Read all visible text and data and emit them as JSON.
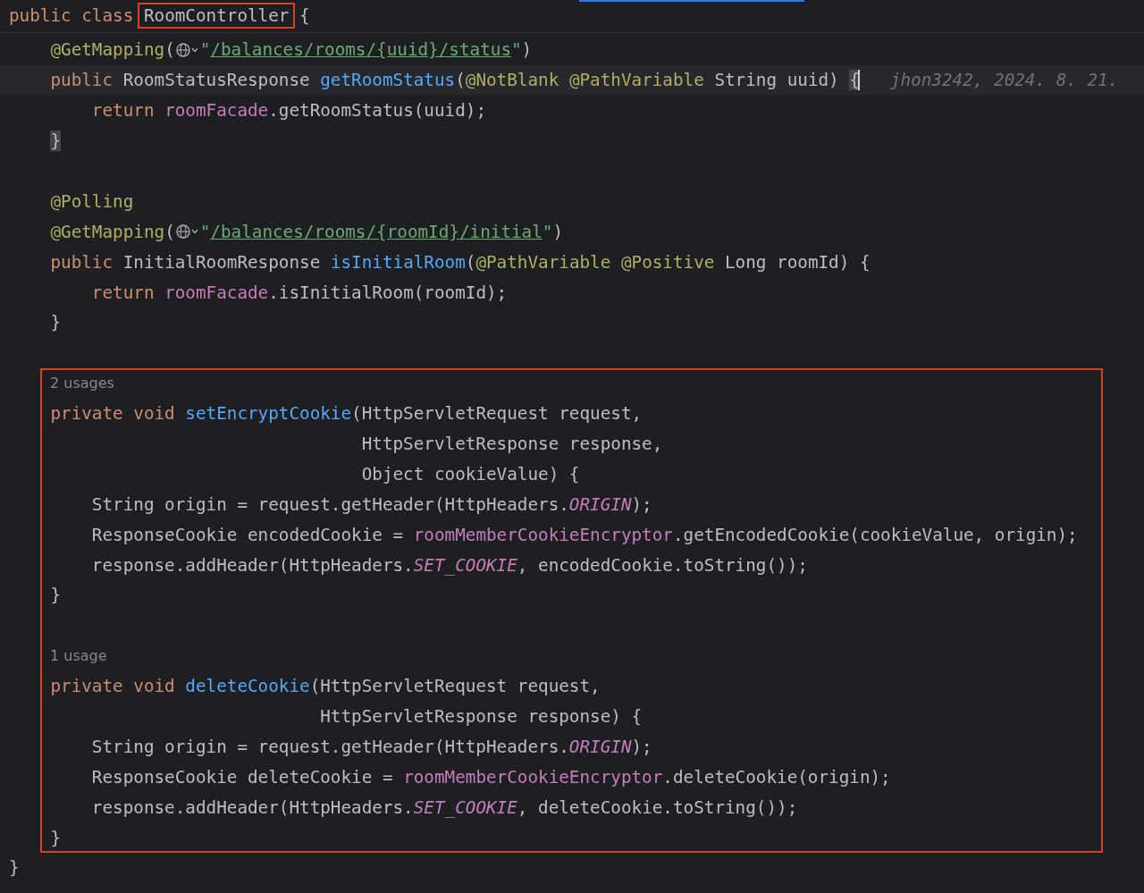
{
  "editor": {
    "sticky_header": {
      "tokens": [
        {
          "text": "public class ",
          "kind": "keyword"
        },
        {
          "text": "RoomController",
          "kind": "plain",
          "boxed": true
        },
        {
          "text": " {",
          "kind": "plain"
        }
      ]
    },
    "sections": [
      {
        "lines": [
          {
            "kind": "code",
            "tokens": [
              {
                "text": "    @GetMapping",
                "kind": "annotation"
              },
              {
                "text": "(",
                "kind": "plain"
              },
              {
                "kind": "globe"
              },
              {
                "text": "\"",
                "kind": "string"
              },
              {
                "text": "/balances/rooms/{uuid}/status",
                "kind": "url"
              },
              {
                "text": "\"",
                "kind": "string"
              },
              {
                "text": ")",
                "kind": "plain"
              }
            ]
          },
          {
            "kind": "code",
            "current": true,
            "tokens": [
              {
                "text": "    public ",
                "kind": "keyword"
              },
              {
                "text": "RoomStatusResponse ",
                "kind": "plain"
              },
              {
                "text": "getRoomStatus",
                "kind": "method"
              },
              {
                "text": "(",
                "kind": "plain"
              },
              {
                "text": "@NotBlank @PathVariable ",
                "kind": "annotation"
              },
              {
                "text": "String uuid) ",
                "kind": "plain"
              },
              {
                "text": "{",
                "kind": "plain",
                "matched": true,
                "caret": true
              }
            ],
            "blame": "jhon3242, 2024. 8. 21."
          },
          {
            "kind": "code",
            "tokens": [
              {
                "text": "        return ",
                "kind": "keyword"
              },
              {
                "text": "roomFacade",
                "kind": "field"
              },
              {
                "text": ".getRoomStatus(uuid);",
                "kind": "plain"
              }
            ]
          },
          {
            "kind": "code",
            "tokens": [
              {
                "text": "    }",
                "kind": "plain",
                "matched": true
              }
            ]
          },
          {
            "kind": "blank"
          },
          {
            "kind": "code",
            "tokens": [
              {
                "text": "    @Polling",
                "kind": "annotation"
              }
            ]
          },
          {
            "kind": "code",
            "tokens": [
              {
                "text": "    @GetMapping",
                "kind": "annotation"
              },
              {
                "text": "(",
                "kind": "plain"
              },
              {
                "kind": "globe"
              },
              {
                "text": "\"",
                "kind": "string"
              },
              {
                "text": "/balances/rooms/{roomId}/initial",
                "kind": "url"
              },
              {
                "text": "\"",
                "kind": "string"
              },
              {
                "text": ")",
                "kind": "plain"
              }
            ]
          },
          {
            "kind": "code",
            "tokens": [
              {
                "text": "    public ",
                "kind": "keyword"
              },
              {
                "text": "InitialRoomResponse ",
                "kind": "plain"
              },
              {
                "text": "isInitialRoom",
                "kind": "method"
              },
              {
                "text": "(",
                "kind": "plain"
              },
              {
                "text": "@PathVariable @Positive ",
                "kind": "annotation"
              },
              {
                "text": "Long roomId) {",
                "kind": "plain"
              }
            ]
          },
          {
            "kind": "code",
            "tokens": [
              {
                "text": "        return ",
                "kind": "keyword"
              },
              {
                "text": "roomFacade",
                "kind": "field"
              },
              {
                "text": ".isInitialRoom(roomId);",
                "kind": "plain"
              }
            ]
          },
          {
            "kind": "code",
            "tokens": [
              {
                "text": "    }",
                "kind": "plain"
              }
            ]
          },
          {
            "kind": "blank"
          }
        ]
      },
      {
        "framed": true,
        "lines": [
          {
            "kind": "hint",
            "text": "2 usages"
          },
          {
            "kind": "code",
            "tokens": [
              {
                "text": "    private void ",
                "kind": "keyword"
              },
              {
                "text": "setEncryptCookie",
                "kind": "method"
              },
              {
                "text": "(HttpServletRequest request,",
                "kind": "plain"
              }
            ]
          },
          {
            "kind": "code",
            "tokens": [
              {
                "text": "                                  HttpServletResponse response,",
                "kind": "plain"
              }
            ]
          },
          {
            "kind": "code",
            "tokens": [
              {
                "text": "                                  Object cookieValue) {",
                "kind": "plain"
              }
            ]
          },
          {
            "kind": "code",
            "tokens": [
              {
                "text": "        String origin = request.getHeader(HttpHeaders.",
                "kind": "plain"
              },
              {
                "text": "ORIGIN",
                "kind": "constant"
              },
              {
                "text": ");",
                "kind": "plain"
              }
            ]
          },
          {
            "kind": "code",
            "tokens": [
              {
                "text": "        ResponseCookie encodedCookie = ",
                "kind": "plain"
              },
              {
                "text": "roomMemberCookieEncryptor",
                "kind": "field"
              },
              {
                "text": ".getEncodedCookie(cookieValue, origin);",
                "kind": "plain"
              }
            ]
          },
          {
            "kind": "code",
            "tokens": [
              {
                "text": "        response.addHeader(HttpHeaders.",
                "kind": "plain"
              },
              {
                "text": "SET_COOKIE",
                "kind": "constant"
              },
              {
                "text": ", encodedCookie.toString());",
                "kind": "plain"
              }
            ]
          },
          {
            "kind": "code",
            "tokens": [
              {
                "text": "    }",
                "kind": "plain"
              }
            ]
          },
          {
            "kind": "blank"
          },
          {
            "kind": "hint",
            "text": "1 usage"
          },
          {
            "kind": "code",
            "tokens": [
              {
                "text": "    private void ",
                "kind": "keyword"
              },
              {
                "text": "deleteCookie",
                "kind": "method"
              },
              {
                "text": "(HttpServletRequest request,",
                "kind": "plain"
              }
            ]
          },
          {
            "kind": "code",
            "tokens": [
              {
                "text": "                              HttpServletResponse response) {",
                "kind": "plain"
              }
            ]
          },
          {
            "kind": "code",
            "tokens": [
              {
                "text": "        String origin = request.getHeader(HttpHeaders.",
                "kind": "plain"
              },
              {
                "text": "ORIGIN",
                "kind": "constant"
              },
              {
                "text": ");",
                "kind": "plain"
              }
            ]
          },
          {
            "kind": "code",
            "tokens": [
              {
                "text": "        ResponseCookie deleteCookie = ",
                "kind": "plain"
              },
              {
                "text": "roomMemberCookieEncryptor",
                "kind": "field"
              },
              {
                "text": ".deleteCookie(origin);",
                "kind": "plain"
              }
            ]
          },
          {
            "kind": "code",
            "tokens": [
              {
                "text": "        response.addHeader(HttpHeaders.",
                "kind": "plain"
              },
              {
                "text": "SET_COOKIE",
                "kind": "constant"
              },
              {
                "text": ", deleteCookie.toString());",
                "kind": "plain"
              }
            ]
          },
          {
            "kind": "code",
            "tokens": [
              {
                "text": "    }",
                "kind": "plain"
              }
            ]
          }
        ]
      },
      {
        "lines": [
          {
            "kind": "code",
            "tokens": [
              {
                "text": "}",
                "kind": "plain"
              }
            ]
          }
        ]
      }
    ]
  }
}
